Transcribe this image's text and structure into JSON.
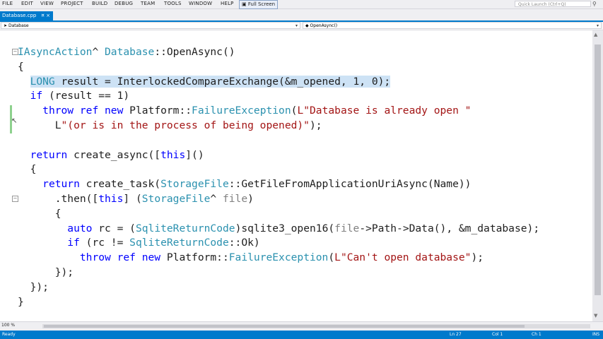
{
  "menu": [
    "FILE",
    "EDIT",
    "VIEW",
    "PROJECT",
    "BUILD",
    "DEBUG",
    "TEAM",
    "TOOLS",
    "WINDOW",
    "HELP"
  ],
  "fullscreen_label": "Full Screen",
  "quick_launch_placeholder": "Quick Launch (Ctrl+Q)",
  "tab": {
    "label": "Database.cpp",
    "pin": "¤",
    "close": "×"
  },
  "nav": {
    "left": "Database",
    "right": "OpenAsync()"
  },
  "code": [
    [
      [
        "IAsyncAction",
        "ty"
      ],
      [
        "^ ",
        ""
      ],
      [
        "Database",
        "ty"
      ],
      [
        "::OpenAsync()",
        ""
      ]
    ],
    [
      [
        "{",
        ""
      ]
    ],
    [
      [
        "  ",
        ""
      ],
      [
        "LONG",
        "ty"
      ],
      [
        " result = InterlockedCompareExchange(&m_opened, 1, 0);",
        ""
      ]
    ],
    [
      [
        "  ",
        ""
      ],
      [
        "if",
        "kw"
      ],
      [
        " (result == 1)",
        ""
      ]
    ],
    [
      [
        "    ",
        ""
      ],
      [
        "throw ref new",
        "kw"
      ],
      [
        " Platform::",
        ""
      ],
      [
        "FailureException",
        "ty"
      ],
      [
        "(",
        ""
      ],
      [
        "L\"Database is already open \"",
        "st"
      ]
    ],
    [
      [
        "      L",
        ""
      ],
      [
        "\"(or is in the process of being opened)\"",
        "st"
      ],
      [
        ");",
        ""
      ]
    ],
    [
      [
        "",
        ""
      ]
    ],
    [
      [
        "  ",
        ""
      ],
      [
        "return",
        "kw"
      ],
      [
        " create_async([",
        ""
      ],
      [
        "this",
        "kw"
      ],
      [
        "]()",
        ""
      ]
    ],
    [
      [
        "  {",
        ""
      ]
    ],
    [
      [
        "    ",
        ""
      ],
      [
        "return",
        "kw"
      ],
      [
        " create_task(",
        ""
      ],
      [
        "StorageFile",
        "ty"
      ],
      [
        "::GetFileFromApplicationUriAsync(Name))",
        ""
      ]
    ],
    [
      [
        "      .then([",
        ""
      ],
      [
        "this",
        "kw"
      ],
      [
        "] (",
        ""
      ],
      [
        "StorageFile",
        "ty"
      ],
      [
        "^ ",
        ""
      ],
      [
        "file",
        "pa"
      ],
      [
        ")",
        ""
      ]
    ],
    [
      [
        "      {",
        ""
      ]
    ],
    [
      [
        "        ",
        ""
      ],
      [
        "auto",
        "kw"
      ],
      [
        " rc = (",
        ""
      ],
      [
        "SqliteReturnCode",
        "ty"
      ],
      [
        ")sqlite3_open16(",
        ""
      ],
      [
        "file",
        "pa"
      ],
      [
        "->Path->Data(), &m_database);",
        ""
      ]
    ],
    [
      [
        "        ",
        ""
      ],
      [
        "if",
        "kw"
      ],
      [
        " (rc != ",
        ""
      ],
      [
        "SqliteReturnCode",
        "ty"
      ],
      [
        "::Ok)",
        ""
      ]
    ],
    [
      [
        "          ",
        ""
      ],
      [
        "throw ref new",
        "kw"
      ],
      [
        " Platform::",
        ""
      ],
      [
        "FailureException",
        "ty"
      ],
      [
        "(",
        ""
      ],
      [
        "L\"Can't open database\"",
        "st"
      ],
      [
        ");",
        ""
      ]
    ],
    [
      [
        "      });",
        ""
      ]
    ],
    [
      [
        "  });",
        ""
      ]
    ],
    [
      [
        "}",
        ""
      ]
    ]
  ],
  "zoom": "100 %",
  "status": {
    "ready": "Ready",
    "ln": "Ln 27",
    "col": "Col 1",
    "ch": "Ch 1",
    "ins": "INS"
  },
  "colors": {
    "keyword": "#0000ff",
    "type": "#2b91af",
    "string": "#a31515",
    "param": "#808080",
    "accent": "#007acc",
    "highlight": "#cde2f5"
  }
}
